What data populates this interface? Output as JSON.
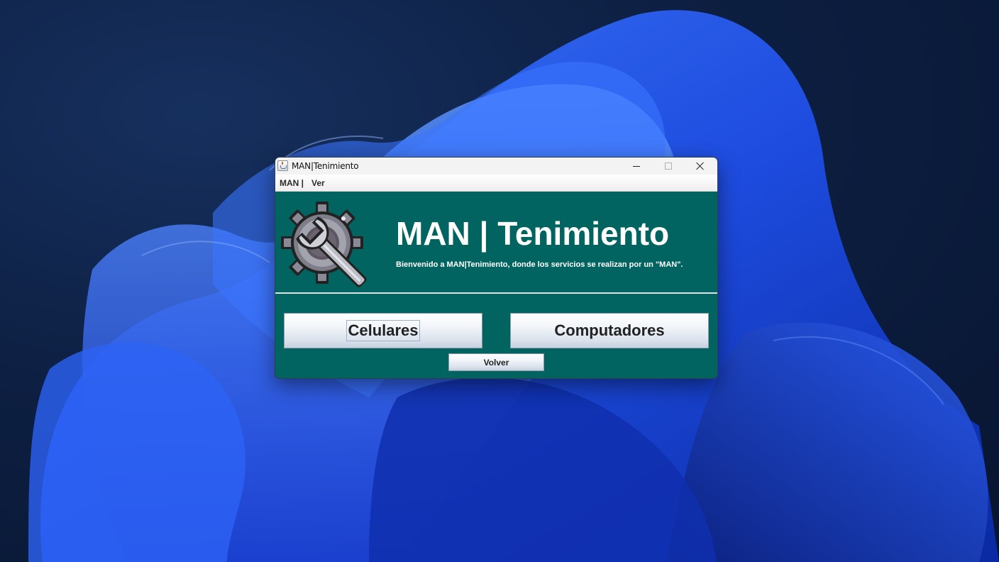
{
  "window": {
    "title": "MAN|Tenimiento"
  },
  "menubar": {
    "items": [
      "MAN |",
      "Ver"
    ]
  },
  "header": {
    "title": "MAN | Tenimiento",
    "subtitle": "Bienvenido a MAN|Tenimiento, donde los servicios se realizan por un \"MAN\"."
  },
  "buttons": {
    "celulares": "Celulares",
    "computadores": "Computadores",
    "volver": "Volver"
  },
  "colors": {
    "panel_background": "#016460",
    "text": "#ffffff"
  },
  "icons": {
    "logo": "gear-wrench-icon",
    "window": "java-cup-icon"
  }
}
